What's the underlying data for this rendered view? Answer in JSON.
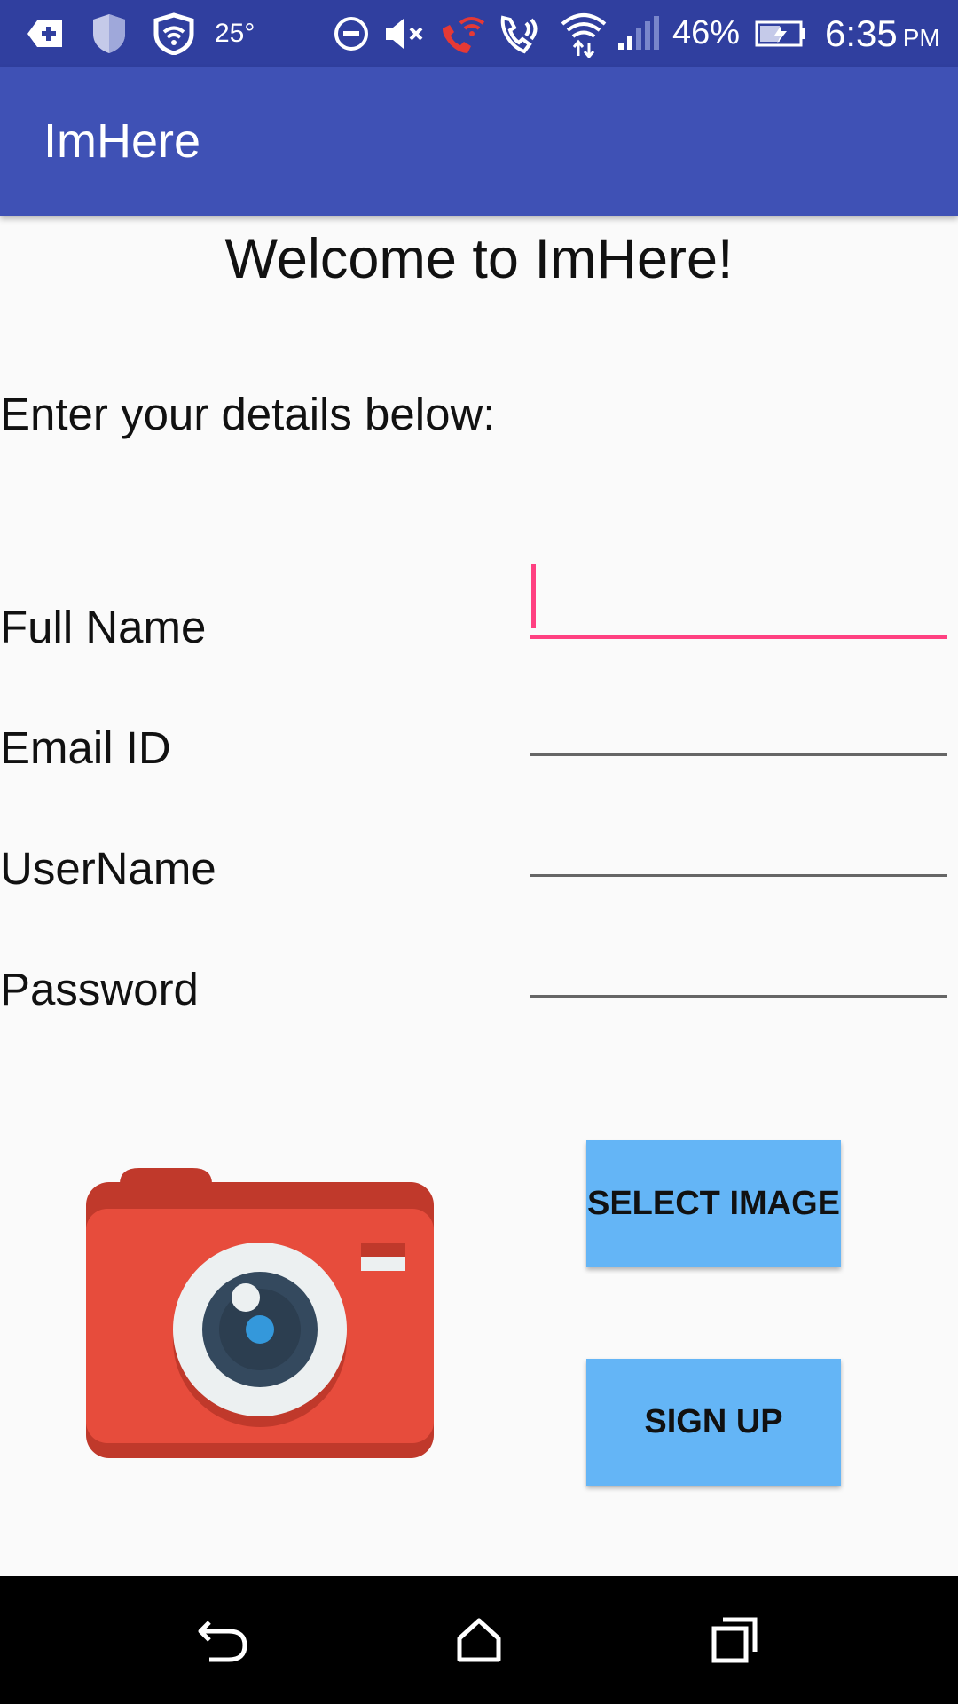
{
  "status_bar": {
    "temperature": "25°",
    "battery_percent": "46%",
    "time": "6:35",
    "ampm": "PM",
    "icons": [
      "message-plus-icon",
      "shield-icon",
      "wifi-shield-icon",
      "do-not-disturb-icon",
      "mute-icon",
      "wifi-call-icon",
      "volte-icon",
      "wifi-icon",
      "signal-icon",
      "battery-charging-icon"
    ],
    "accent_call_color": "#e53935"
  },
  "app_bar": {
    "title": "ImHere",
    "color": "#3f51b5"
  },
  "content": {
    "welcome": "Welcome to ImHere!",
    "subtitle": "Enter your details below:"
  },
  "form": {
    "full_name": {
      "label": "Full Name",
      "value": ""
    },
    "email": {
      "label": "Email ID",
      "value": ""
    },
    "username": {
      "label": "UserName",
      "value": ""
    },
    "password": {
      "label": "Password",
      "value": ""
    },
    "focus_color": "#ff4081"
  },
  "buttons": {
    "select_image": "SELECT IMAGE",
    "sign_up": "SIGN UP",
    "color": "#64b5f6"
  },
  "camera_icon": "camera-icon",
  "nav_bar": {
    "icons": [
      "back-icon",
      "home-icon",
      "recents-icon"
    ]
  }
}
